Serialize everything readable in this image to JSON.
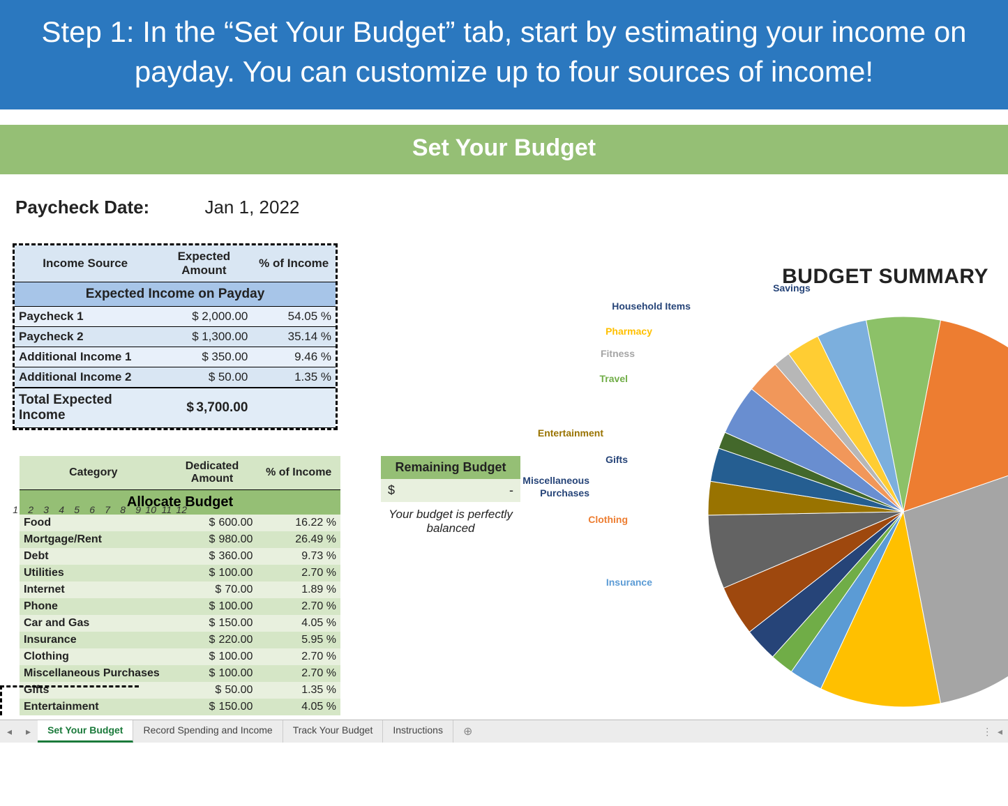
{
  "banner": "Step 1: In the “Set Your Budget” tab, start by estimating your income on payday. You can customize up to four sources of income!",
  "greenBar": "Set Your Budget",
  "paycheckLabel": "Paycheck Date:",
  "paycheckDate": "Jan 1, 2022",
  "income": {
    "title": "Expected Income on Payday",
    "h1": "Income Source",
    "h2": "Expected Amount",
    "h3": "% of Income",
    "rows": [
      {
        "src": "Paycheck 1",
        "amt": "2,000.00",
        "pct": "54.05 %"
      },
      {
        "src": "Paycheck 2",
        "amt": "1,300.00",
        "pct": "35.14 %"
      },
      {
        "src": "Additional Income 1",
        "amt": "350.00",
        "pct": "9.46 %"
      },
      {
        "src": "Additional Income 2",
        "amt": "50.00",
        "pct": "1.35 %"
      }
    ],
    "totalLabel": "Total Expected Income",
    "totalAmt": "3,700.00"
  },
  "alloc": {
    "title": "Allocate Budget",
    "h1": "Category",
    "h2": "Dedicated Amount",
    "h3": "% of Income",
    "rows": [
      {
        "n": "1",
        "cat": "Food",
        "amt": "600.00",
        "pct": "16.22 %"
      },
      {
        "n": "2",
        "cat": "Mortgage/Rent",
        "amt": "980.00",
        "pct": "26.49 %"
      },
      {
        "n": "3",
        "cat": "Debt",
        "amt": "360.00",
        "pct": "9.73 %"
      },
      {
        "n": "4",
        "cat": "Utilities",
        "amt": "100.00",
        "pct": "2.70 %"
      },
      {
        "n": "5",
        "cat": "Internet",
        "amt": "70.00",
        "pct": "1.89 %"
      },
      {
        "n": "6",
        "cat": "Phone",
        "amt": "100.00",
        "pct": "2.70 %"
      },
      {
        "n": "7",
        "cat": "Car and Gas",
        "amt": "150.00",
        "pct": "4.05 %"
      },
      {
        "n": "8",
        "cat": "Insurance",
        "amt": "220.00",
        "pct": "5.95 %"
      },
      {
        "n": "9",
        "cat": "Clothing",
        "amt": "100.00",
        "pct": "2.70 %"
      },
      {
        "n": "10",
        "cat": "Miscellaneous Purchases",
        "amt": "100.00",
        "pct": "2.70 %"
      },
      {
        "n": "11",
        "cat": "Gifts",
        "amt": "50.00",
        "pct": "1.35 %"
      },
      {
        "n": "12",
        "cat": "Entertainment",
        "amt": "150.00",
        "pct": "4.05 %"
      }
    ]
  },
  "remaining": {
    "title": "Remaining Budget",
    "valPrefix": "$",
    "val": "-",
    "msg": "Your budget is perfectly balanced"
  },
  "chart": {
    "title": "BUDGET SUMMARY"
  },
  "chart_data": {
    "type": "pie",
    "title": "BUDGET SUMMARY",
    "series": [
      {
        "name": "Food",
        "value": 600,
        "color": "#ed7d31"
      },
      {
        "name": "Mortgage/Rent",
        "value": 980,
        "color": "#a5a5a5"
      },
      {
        "name": "Debt",
        "value": 360,
        "color": "#ffc000"
      },
      {
        "name": "Utilities",
        "value": 100,
        "color": "#5b9bd5"
      },
      {
        "name": "Internet",
        "value": 70,
        "color": "#70ad47"
      },
      {
        "name": "Phone",
        "value": 100,
        "color": "#264478"
      },
      {
        "name": "Car and Gas",
        "value": 150,
        "color": "#9e480e"
      },
      {
        "name": "Insurance",
        "value": 220,
        "color": "#636363"
      },
      {
        "name": "Clothing",
        "value": 100,
        "color": "#997300"
      },
      {
        "name": "Miscellaneous Purchases",
        "value": 100,
        "color": "#255e91"
      },
      {
        "name": "Gifts",
        "value": 50,
        "color": "#43682b"
      },
      {
        "name": "Entertainment",
        "value": 150,
        "color": "#698ed0"
      },
      {
        "name": "Travel",
        "value": 100,
        "color": "#f1975a"
      },
      {
        "name": "Fitness",
        "value": 50,
        "color": "#b7b7b7"
      },
      {
        "name": "Pharmacy",
        "value": 100,
        "color": "#ffcd33"
      },
      {
        "name": "Household Items",
        "value": 150,
        "color": "#7cafdd"
      },
      {
        "name": "Savings",
        "value": 220,
        "color": "#8cc168"
      }
    ],
    "labels_visible": [
      "Savings",
      "Household Items",
      "Pharmacy",
      "Fitness",
      "Travel",
      "Entertainment",
      "Gifts",
      "Miscellaneous Purchases",
      "Clothing",
      "Insurance"
    ],
    "label_colors": {
      "Savings": "#264478",
      "Household Items": "#264478",
      "Pharmacy": "#ffc000",
      "Fitness": "#a5a5a5",
      "Travel": "#70ad47",
      "Entertainment": "#997300",
      "Gifts": "#264478",
      "Miscellaneous Purchases": "#264478",
      "Clothing": "#ed7d31",
      "Insurance": "#5b9bd5"
    }
  },
  "tabs": {
    "items": [
      "Set Your Budget",
      "Record Spending and Income",
      "Track Your Budget",
      "Instructions"
    ],
    "activeIndex": 0
  }
}
